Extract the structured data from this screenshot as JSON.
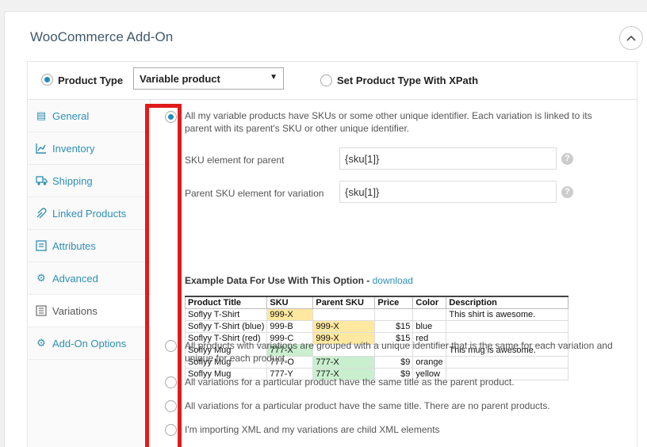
{
  "panel": {
    "title": "WooCommerce Add-On"
  },
  "product_type": {
    "label": "Product Type",
    "select_value": "Variable product",
    "xpath_label": "Set Product Type With XPath"
  },
  "sidebar": {
    "items": [
      {
        "label": "General",
        "icon": "general-icon"
      },
      {
        "label": "Inventory",
        "icon": "inventory-icon"
      },
      {
        "label": "Shipping",
        "icon": "shipping-icon"
      },
      {
        "label": "Linked Products",
        "icon": "linked-products-icon"
      },
      {
        "label": "Attributes",
        "icon": "attributes-icon"
      },
      {
        "label": "Advanced",
        "icon": "gear-icon"
      },
      {
        "label": "Variations",
        "icon": "variations-icon"
      },
      {
        "label": "Add-On Options",
        "icon": "gear-icon"
      }
    ]
  },
  "variations": {
    "option1": "All my variable products have SKUs or some other unique identifier. Each variation is linked to its parent with its parent's SKU or other unique identifier.",
    "sku_parent_label": "SKU element for parent",
    "sku_parent_value": "{sku[1]}",
    "parent_sku_label": "Parent SKU element for variation",
    "parent_sku_value": "{sku[1]}",
    "example_title": "Example Data For Use With This Option",
    "example_sep": " - ",
    "example_link": "download",
    "option2": "All products with variations are grouped with a unique identifier that is the same for each variation and unique for each product.",
    "option3": "All variations for a particular product have the same title as the parent product.",
    "option4": "All variations for a particular product have the same title. There are no parent products.",
    "option5": "I'm importing XML and my variations are child XML elements"
  },
  "example_table": {
    "headers": [
      "Product Title",
      "SKU",
      "Parent SKU",
      "Price",
      "Color",
      "Description"
    ],
    "rows": [
      [
        "Soflyy T-Shirt",
        "999-X",
        "",
        "",
        "",
        "This shirt is awesome."
      ],
      [
        "Soflyy T-Shirt (blue)",
        "999-B",
        "999-X",
        "$15",
        "blue",
        ""
      ],
      [
        "Soflyy T-Shirt (red)",
        "999-C",
        "999-X",
        "$15",
        "red",
        ""
      ],
      [
        "Soflyy Mug",
        "777-X",
        "",
        "",
        "",
        "This mug is awesome."
      ],
      [
        "Soflyy Mug",
        "777-O",
        "777-X",
        "$9",
        "orange",
        ""
      ],
      [
        "Soflyy Mug",
        "777-Y",
        "777-X",
        "$9",
        "yellow",
        ""
      ]
    ],
    "highlights": {
      "yellow": "#ffe8a0",
      "green": "#c9efcf"
    }
  },
  "colors": {
    "accent": "#2e8fb4",
    "highlight_border": "#e01b1b",
    "title": "#40596b"
  }
}
